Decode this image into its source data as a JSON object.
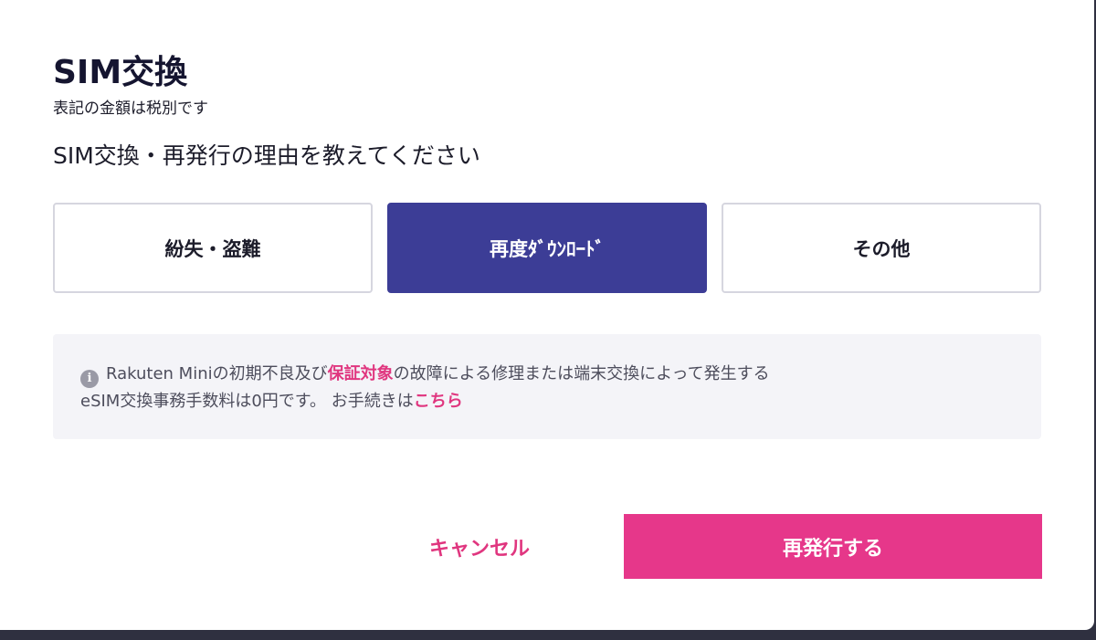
{
  "modal": {
    "title": "SIM交換",
    "tax_note": "表記の金額は税別です",
    "question": "SIM交換・再発行の理由を教えてください"
  },
  "options": [
    {
      "label": "紛失・盗難",
      "selected": false
    },
    {
      "label": "再度ﾀﾞｳﾝﾛｰﾄﾞ",
      "selected": true
    },
    {
      "label": "その他",
      "selected": false
    }
  ],
  "info": {
    "icon": "info-icon",
    "icon_glyph": "i",
    "text_1": "Rakuten Miniの初期不良及び",
    "link_1": "保証対象",
    "text_2": "の故障による修理または端末交換によって発生する",
    "text_3": "eSIM交換事務手数料は0円です。 お手続きは",
    "link_2": "こちら"
  },
  "actions": {
    "cancel_label": "キャンセル",
    "submit_label": "再発行する"
  },
  "colors": {
    "selected_option": "#3c3d96",
    "accent_pink": "#e6378a",
    "link_pink": "#e0367f"
  }
}
